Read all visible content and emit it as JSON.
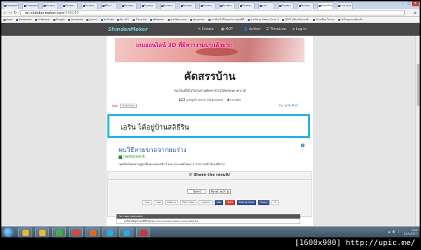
{
  "browser": {
    "tabs": [
      "Facebook",
      "Creepypas",
      "ร้องเพลง",
      "ร้องเพลง",
      "ร้องเพลง",
      "วิธีการ",
      "ร้องเพลง",
      "ร้องเพลง",
      "ร้องเพลง",
      "ร้องเพลง",
      "ร้องเพลง",
      "ร้องเพลง",
      "ร้องเพลง",
      "ภาพ",
      "ร้องเพลง",
      "ร้องเพลง",
      "คัดสรรบ้าน",
      "เรามาลอง"
    ],
    "url_host": "en.shindanmaker.com",
    "url_path": "/448144",
    "bookmarks": [
      "Apps",
      "Karaboom",
      "LnNovels",
      "Google",
      "Facebook",
      "[pixiv]",
      "YouTube",
      "My ACL",
      "Tinka Kit",
      "Webtoon",
      "mailbox.com",
      "vkcomics",
      "การบ้านไม่ได้จุดประกายค่าที่ดี",
      "อ่านนิยาย Kamo Chan 2",
      "[DOT] ต้อนรับพวกเจ้า",
      "บ้านเพื่อน ไม่มาก",
      "วันไหนอยากต้อนรับ"
    ]
  },
  "site": {
    "logo": "ShindanMaker",
    "nav": {
      "create": "Create",
      "hot": "HOT",
      "author": "Author",
      "timeline": "TimeLine",
      "login": "Log in"
    }
  },
  "banner": {
    "text": "เกมออนไลน์ 3D ที่มีสาวงามมาแล้วมาก"
  },
  "diagnosis": {
    "title": "คัดสรรบ้าน",
    "description": "จับเรียนที่มีไม่ไปกับบ้านคัดสรรบ้านให้ทุกคนดาคาเวลี",
    "diagnosed_count": "217",
    "diagnosed_label": "people were diagnosed",
    "results_count": "4",
    "results_label": "results",
    "hot_label": "Hot:",
    "tag": "Questions",
    "author_prefix": "by",
    "author": "@NeMeh",
    "result_text": "เอริน ได้อยู่บ้านสลิธีริน"
  },
  "ad": {
    "title": "พบวิธีหายขาดจากผมร่วง",
    "site": "hairegrow.tk",
    "text": "เทคนิคใหม่ผสานสูตรขั้นพระยอดบรีเวโคลน ประเทศไทยมาก สามารถทำได้เองที่บ้าน"
  },
  "share": {
    "heading": "Share the result!",
    "tweet": "Tweet",
    "tweet_at": "Tweet with @",
    "buttons": [
      "Line",
      "mixi",
      "Hatena",
      "Mixi check",
      "cyworld",
      "Like",
      "G+1",
      "Post to Feed",
      "Share",
      "15"
    ],
    "copy_label": "For copy and paste",
    "copy_text": "เอรินได้อยู่บ้านสลิธีรินhttp://en.shindanmaker.com/448144"
  },
  "taskbar": {
    "time": "0:02",
    "date": "10/5/2557",
    "colors": [
      "#e8b73a",
      "#e8b73a",
      "#3fae49",
      "#e34133",
      "#d86a2a",
      "#2aa8e0",
      "#2aa8e0",
      "#cc3333"
    ]
  },
  "caption": "[1600x900] http://upic.me/"
}
